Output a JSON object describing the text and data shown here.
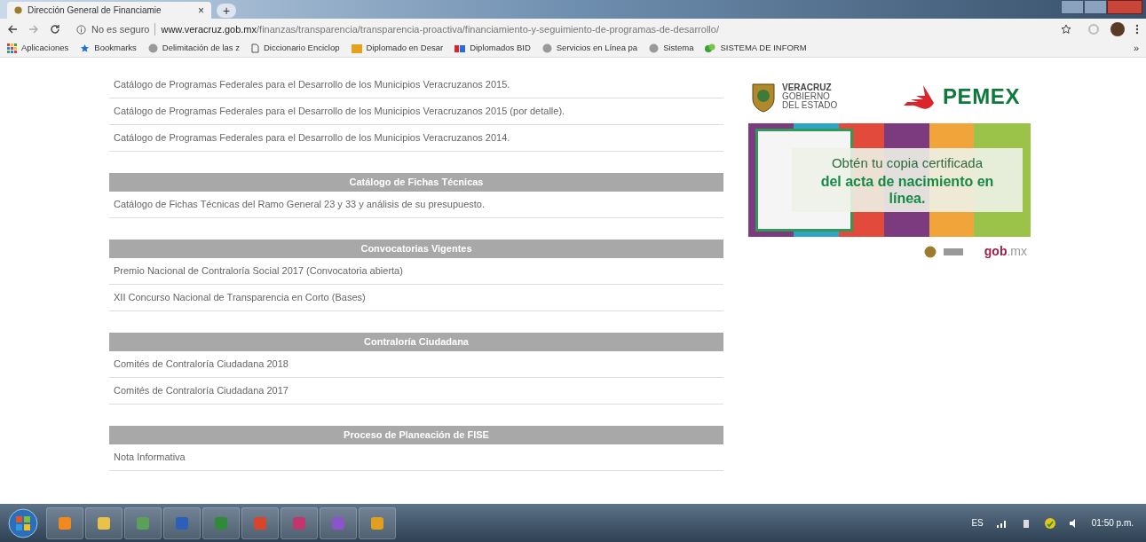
{
  "browser": {
    "tab": {
      "title": "Dirección General de Financiamie",
      "close": "×"
    },
    "new_tab": "+",
    "security": "No es seguro",
    "url_host": "www.veracruz.gob.mx",
    "url_path": "/finanzas/transparencia/transparencia-proactiva/financiamiento-y-seguimiento-de-programas-de-desarrollo/",
    "bookmarks": [
      {
        "label": "Aplicaciones",
        "kind": "apps"
      },
      {
        "label": "Bookmarks",
        "kind": "star"
      },
      {
        "label": "Delimitación de las z",
        "kind": "globe"
      },
      {
        "label": "Diccionario Enciclop",
        "kind": "page"
      },
      {
        "label": "Diplomado en Desar",
        "kind": "tn"
      },
      {
        "label": "Diplomados BID",
        "kind": "edx"
      },
      {
        "label": "Servicios en Línea pa",
        "kind": "globe"
      },
      {
        "label": "Sistema",
        "kind": "globe"
      },
      {
        "label": "SISTEMA DE INFORM",
        "kind": "green"
      }
    ],
    "more": "»"
  },
  "content": {
    "top_links": [
      "Catálogo de Programas Federales para el Desarrollo de los Municipios Veracruzanos 2015.",
      "Catálogo de Programas Federales para el Desarrollo de los Municipios Veracruzanos 2015 (por detalle).",
      "Catálogo de Programas Federales para el Desarrollo de los Municipios Veracruzanos 2014."
    ],
    "sections": [
      {
        "title": "Catálogo de Fichas Técnicas",
        "links": [
          "Catálogo de Fichas Técnicas del Ramo General 23 y 33 y análisis de su presupuesto."
        ]
      },
      {
        "title": "Convocatorias Vigentes",
        "links": [
          "Premio Nacional de Contraloría Social 2017 (Convocatoria abierta)",
          "XII Concurso Nacional de Transparencia en Corto (Bases)"
        ]
      },
      {
        "title": "Contraloría Ciudadana",
        "links": [
          "Comités de Contraloría Ciudadana 2018",
          "Comités de Contraloría Ciudadana 2017"
        ]
      },
      {
        "title": "Proceso de Planeación de FISE",
        "links": [
          "Nota Informativa"
        ]
      }
    ]
  },
  "sidebar": {
    "logo_lines": [
      "VERACRUZ",
      "GOBIERNO",
      "DEL ESTADO"
    ],
    "pemex": "PEMEX",
    "banner_line1": "Obtén tu copia certificada",
    "banner_line2": "del acta de nacimiento en línea.",
    "gob": "gob",
    "mx": ".mx"
  },
  "taskbar": {
    "apps": [
      {
        "kind": "player"
      },
      {
        "kind": "folder"
      },
      {
        "kind": "calc"
      },
      {
        "kind": "word"
      },
      {
        "kind": "excel"
      },
      {
        "kind": "office"
      },
      {
        "kind": "paint"
      },
      {
        "kind": "itunes"
      },
      {
        "kind": "chrome"
      }
    ],
    "language": "ES",
    "time": "01:50 p.m."
  }
}
